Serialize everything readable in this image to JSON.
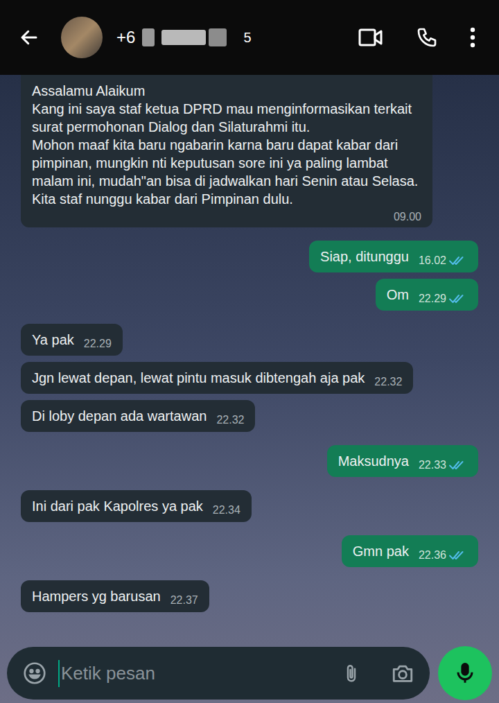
{
  "header": {
    "contact": {
      "prefix": "+6",
      "suffix": "5"
    }
  },
  "messages": [
    {
      "kind": "incoming",
      "text": "Assalamu Alaikum\nKang ini saya staf ketua DPRD mau menginformasikan terkait surat permohonan Dialog dan Silaturahmi itu.\nMohon maaf kita baru ngabarin karna baru dapat kabar dari pimpinan, mungkin nti keputusan sore ini ya paling lambat malam ini, mudah\"an bisa di jadwalkan hari Senin atau Selasa.\nKita staf nunggu kabar dari Pimpinan dulu.",
      "time": "09.00"
    },
    {
      "kind": "outgoing",
      "text": "Siap, ditunggu",
      "time": "16.02",
      "read": true
    },
    {
      "kind": "outgoing",
      "text": "Om",
      "time": "22.29",
      "read": true
    },
    {
      "kind": "incoming",
      "text": "Ya pak",
      "time": "22.29"
    },
    {
      "kind": "incoming",
      "text": "Jgn lewat depan, lewat pintu masuk dibtengah aja pak",
      "time": "22.32"
    },
    {
      "kind": "incoming",
      "text": "Di loby depan ada wartawan",
      "time": "22.32"
    },
    {
      "kind": "outgoing",
      "text": "Maksudnya",
      "time": "22.33",
      "read": true
    },
    {
      "kind": "incoming",
      "text": "Ini dari pak Kapolres ya pak",
      "time": "22.34"
    },
    {
      "kind": "outgoing",
      "text": "Gmn pak",
      "time": "22.36",
      "read": true
    },
    {
      "kind": "incoming",
      "text": "Hampers yg barusan",
      "time": "22.37"
    }
  ],
  "composer": {
    "placeholder": "Ketik pesan"
  }
}
